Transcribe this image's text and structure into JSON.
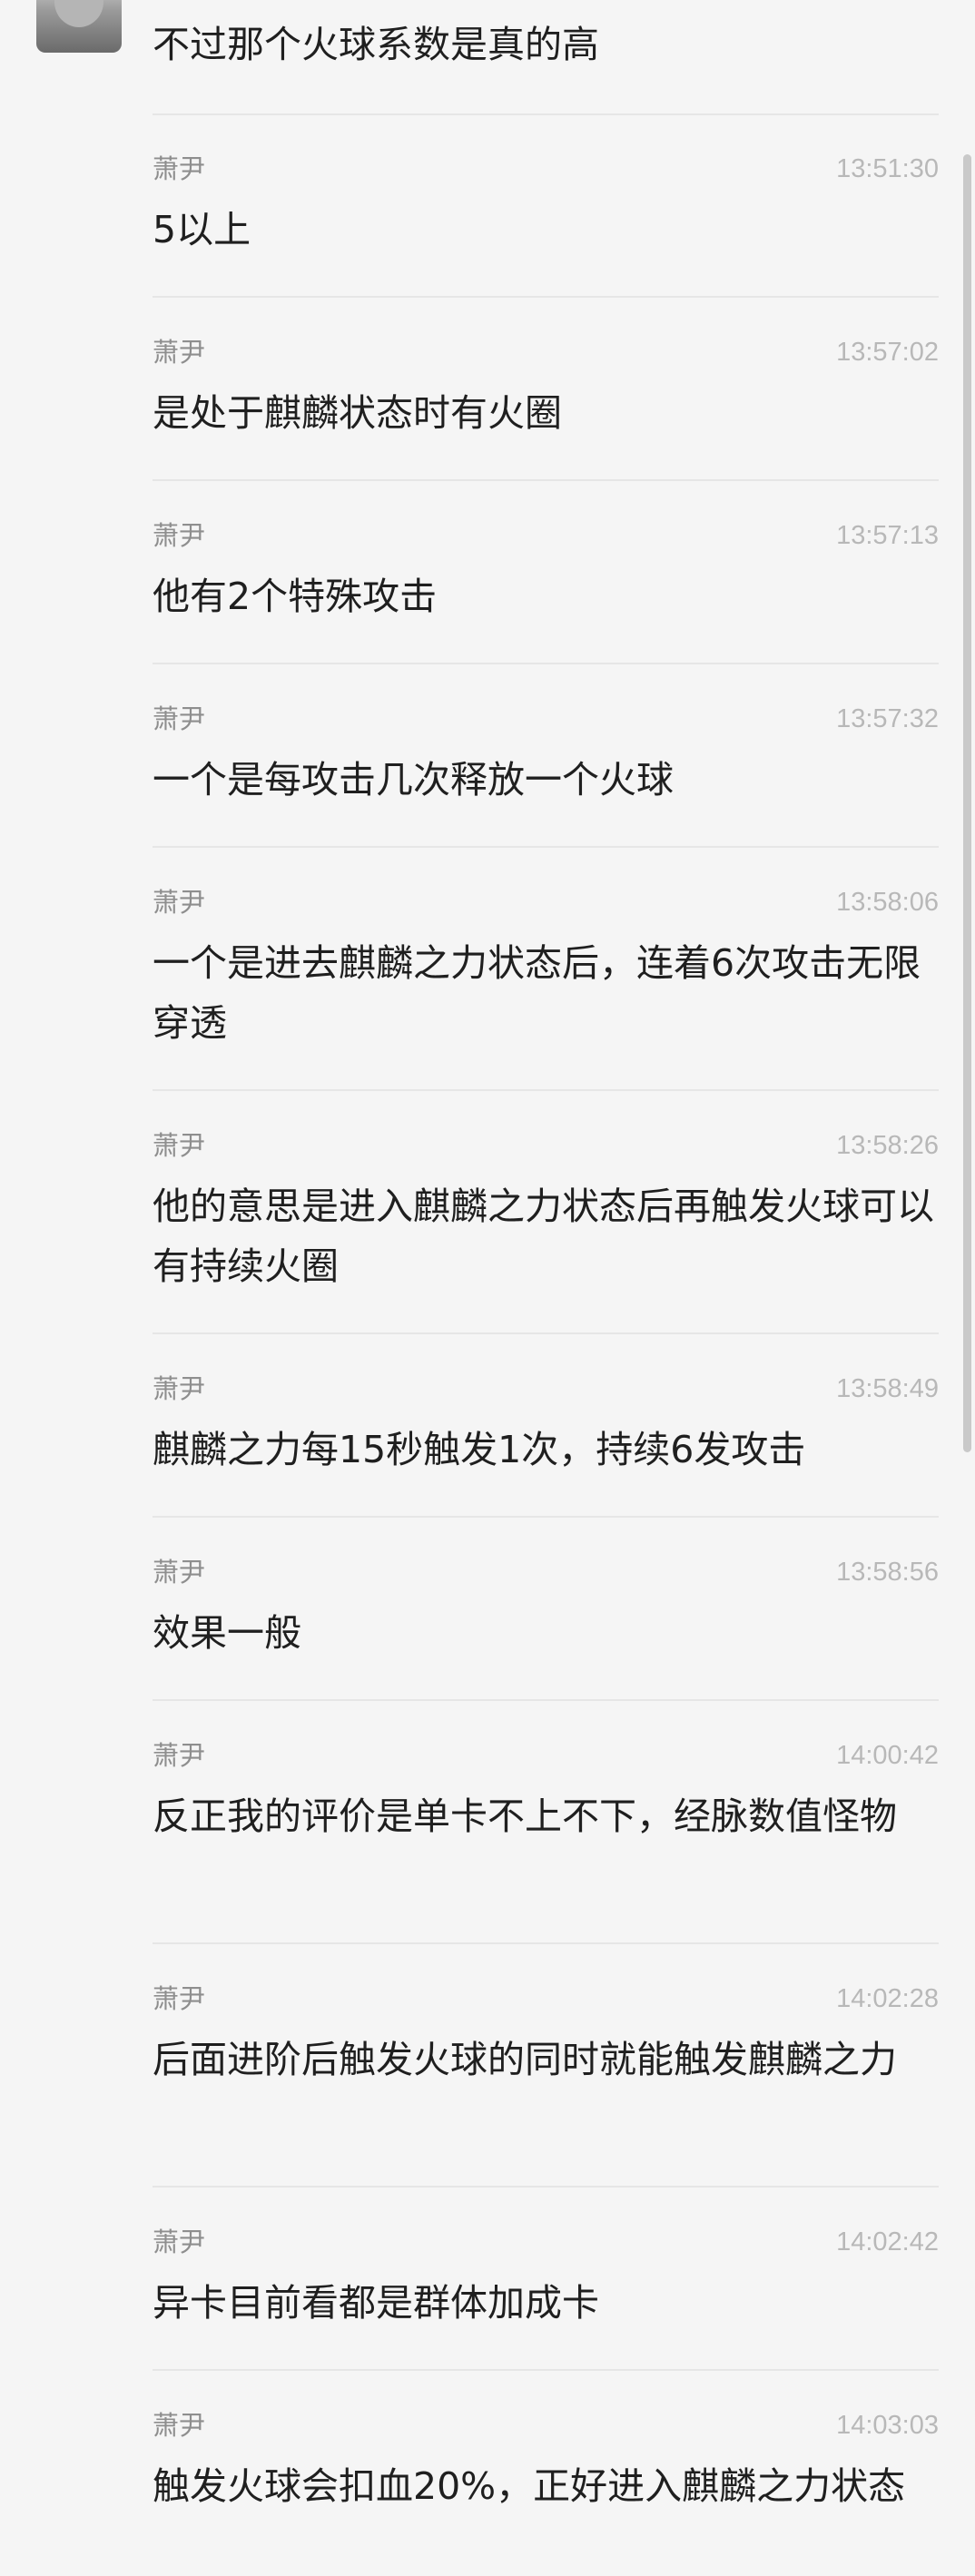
{
  "chat": {
    "first_message": {
      "text": "不过那个火球系数是真的高"
    },
    "messages": [
      {
        "sender": "萧尹",
        "time": "13:51:30",
        "text": "5以上"
      },
      {
        "sender": "萧尹",
        "time": "13:57:02",
        "text": "是处于麒麟状态时有火圈"
      },
      {
        "sender": "萧尹",
        "time": "13:57:13",
        "text": "他有2个特殊攻击"
      },
      {
        "sender": "萧尹",
        "time": "13:57:32",
        "text": "一个是每攻击几次释放一个火球"
      },
      {
        "sender": "萧尹",
        "time": "13:58:06",
        "text": "一个是进去麒麟之力状态后，连着6次攻击无限穿透"
      },
      {
        "sender": "萧尹",
        "time": "13:58:26",
        "text": "他的意思是进入麒麟之力状态后再触发火球可以有持续火圈"
      },
      {
        "sender": "萧尹",
        "time": "13:58:49",
        "text": "麒麟之力每15秒触发1次，持续6发攻击"
      },
      {
        "sender": "萧尹",
        "time": "13:58:56",
        "text": "效果一般"
      },
      {
        "sender": "萧尹",
        "time": "14:00:42",
        "text": "反正我的评价是单卡不上不下，经脉数值怪物"
      },
      {
        "sender": "萧尹",
        "time": "14:02:28",
        "text": "后面进阶后触发火球的同时就能触发麒麟之力"
      },
      {
        "sender": "萧尹",
        "time": "14:02:42",
        "text": "异卡目前看都是群体加成卡"
      },
      {
        "sender": "萧尹",
        "time": "14:03:03",
        "text": "触发火球会扣血20%，正好进入麒麟之力状态"
      }
    ]
  }
}
